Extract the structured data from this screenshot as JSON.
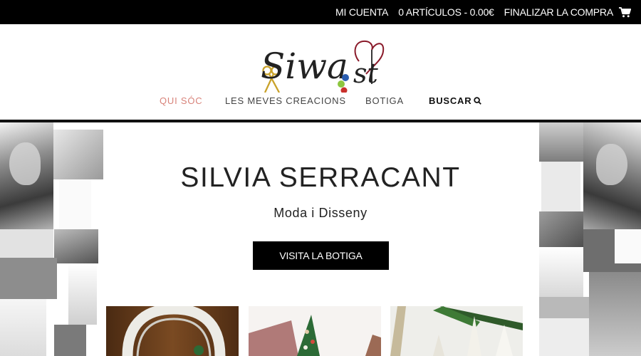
{
  "topbar": {
    "account": "MI CUENTA",
    "cart": "0 ARTÍCULOS - 0.00€",
    "checkout": "FINALIZAR LA COMPRA",
    "cart_icon": "shopping-cart-icon"
  },
  "logo": {
    "text": "Siwa",
    "tail": "st",
    "icons": [
      "scissors-icon",
      "buttons-icon",
      "needle-icon"
    ]
  },
  "nav": {
    "items": [
      {
        "label": "QUI SÓC",
        "active": true
      },
      {
        "label": "LES MEVES CREACIONS",
        "active": false
      },
      {
        "label": "BOTIGA",
        "active": false
      }
    ],
    "search_label": "BUSCAR",
    "search_icon": "search-icon"
  },
  "hero": {
    "title": "SILVIA SERRACANT",
    "subtitle": "Moda i Disseny",
    "button": "VISITA LA BOTIGA"
  },
  "colors": {
    "topbar_bg": "#000000",
    "nav_active": "#d8837a",
    "button_bg": "#000000"
  }
}
